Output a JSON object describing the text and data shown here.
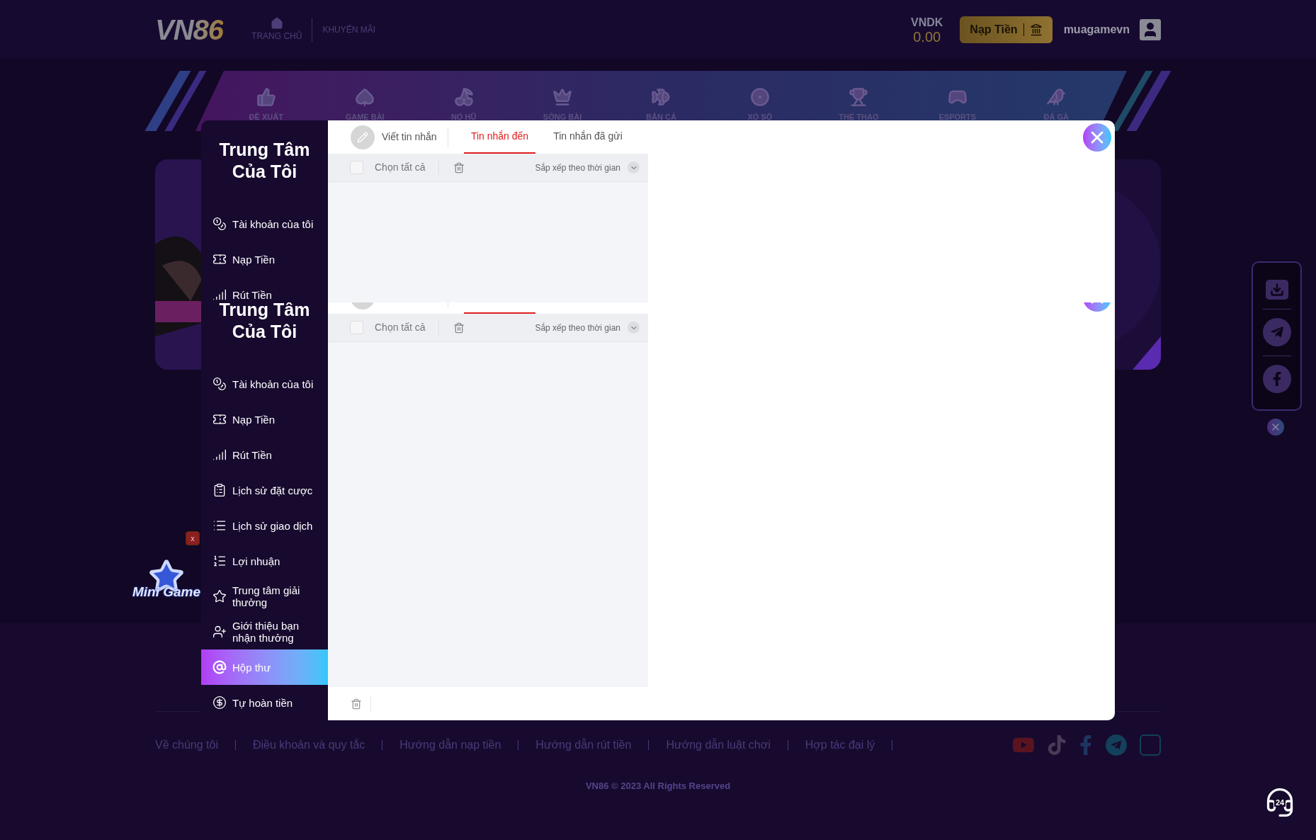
{
  "header": {
    "logo": "VN86",
    "nav": [
      {
        "label": "TRANG CHỦ",
        "kind": "home"
      },
      {
        "label": "KHUYẾN MÃI",
        "kind": "text"
      }
    ],
    "currency": "VNDK",
    "balance": "0.00",
    "deposit_button": "Nạp Tiền",
    "username": "muagamevn"
  },
  "categories": [
    {
      "label": "ĐỀ XUẤT",
      "kind": "recommend"
    },
    {
      "label": "GAME BÀI",
      "kind": "cards"
    },
    {
      "label": "NỔ HŨ",
      "kind": "slots"
    },
    {
      "label": "SÒNG BÀI",
      "kind": "casino"
    },
    {
      "label": "BẮN CÁ",
      "kind": "fish"
    },
    {
      "label": "XỔ SỐ",
      "kind": "lottery"
    },
    {
      "label": "THỂ THAO",
      "kind": "sports"
    },
    {
      "label": "ESPORTS",
      "kind": "esports"
    },
    {
      "label": "ĐÁ GÀ",
      "kind": "cockfight"
    }
  ],
  "inbox_top_slice": {
    "sidebar_title": "Trung Tâm Của Tôi",
    "menu": [
      {
        "label": "Tài khoản của tôi",
        "kind": "account",
        "selected": false
      },
      {
        "label": "Nạp Tiền",
        "kind": "deposit",
        "selected": false
      },
      {
        "label": "Rút Tiền",
        "kind": "withdraw",
        "selected": false
      }
    ],
    "compose": "Viết tin nhắn",
    "tabs": [
      {
        "label": "Tin nhắn đến",
        "selected": true
      },
      {
        "label": "Tin nhắn đã gửi",
        "selected": false
      }
    ],
    "toolbar": {
      "select_all": "Chọn tất cả",
      "checked": false,
      "sort": "Sắp xếp theo thời gian"
    }
  },
  "inbox": {
    "sidebar_title": "Trung Tâm Của Tôi",
    "menu": [
      {
        "label": "Tài khoản của tôi",
        "kind": "account",
        "selected": false
      },
      {
        "label": "Nạp Tiền",
        "kind": "deposit",
        "selected": false
      },
      {
        "label": "Rút Tiền",
        "kind": "withdraw",
        "selected": false
      },
      {
        "label": "Lịch sử đặt cược",
        "kind": "bets",
        "selected": false
      },
      {
        "label": "Lịch sử giao dịch",
        "kind": "transactions",
        "selected": false
      },
      {
        "label": "Lợi nhuận",
        "kind": "profit",
        "selected": false
      },
      {
        "label": "Trung tâm giải thưởng",
        "kind": "rewards",
        "selected": false
      },
      {
        "label": "Giới thiệu bạn nhận thưởng",
        "kind": "referral",
        "selected": false
      },
      {
        "label": "Hộp thư",
        "kind": "inbox",
        "selected": true
      },
      {
        "label": "Tự hoàn tiền",
        "kind": "rebate",
        "selected": false
      }
    ],
    "tabs": [
      {
        "selected": true
      },
      {
        "selected": false
      }
    ],
    "toolbar": {
      "select_all": "Chọn tất cả",
      "checked": false,
      "sort": "Sắp xếp theo thời gian"
    }
  },
  "mini_game": {
    "label": "Mini Game",
    "close": "x"
  },
  "support_badge": "24",
  "footer": {
    "links": [
      "Về chúng tôi",
      "Điều khoản và quy tắc",
      "Hướng dẫn nạp tiền",
      "Hướng dẫn rút tiền",
      "Hướng dẫn luật chơi",
      "Hợp tác đại lý"
    ],
    "copyright": "VN86 © 2023 All Rights Reserved"
  }
}
